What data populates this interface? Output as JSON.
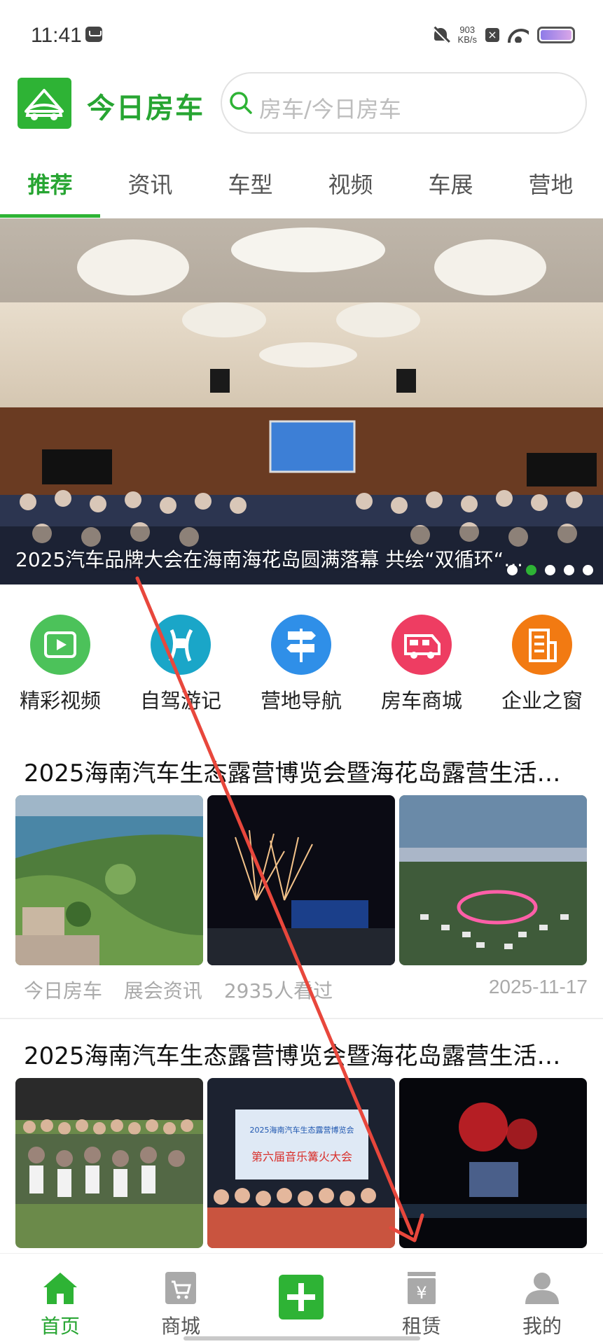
{
  "status_bar": {
    "time": "11:41",
    "net_speed_value": "903",
    "net_speed_unit": "KB/s",
    "icons": [
      "message-icon",
      "mute-icon",
      "close-icon",
      "wifi-icon",
      "battery-icon"
    ]
  },
  "header": {
    "app_name": "今日房车",
    "search_placeholder": "房车/今日房车"
  },
  "tabs": [
    {
      "label": "推荐",
      "active": true
    },
    {
      "label": "资讯",
      "active": false
    },
    {
      "label": "车型",
      "active": false
    },
    {
      "label": "视频",
      "active": false
    },
    {
      "label": "车展",
      "active": false
    },
    {
      "label": "营地",
      "active": false
    }
  ],
  "banner": {
    "caption": "2025汽车品牌大会在海南海花岛圆满落幕 共绘“双循环“…",
    "dot_count": 5,
    "active_dot": 1
  },
  "quick_nav": [
    {
      "label": "精彩视频",
      "icon": "video-icon",
      "color": "#4cc25a"
    },
    {
      "label": "自驾游记",
      "icon": "road-trip-icon",
      "color": "#1aa6c8"
    },
    {
      "label": "营地导航",
      "icon": "signpost-icon",
      "color": "#2f8fe8"
    },
    {
      "label": "房车商城",
      "icon": "rv-icon",
      "color": "#ee3d62"
    },
    {
      "label": "企业之窗",
      "icon": "building-icon",
      "color": "#f27a12"
    }
  ],
  "articles": [
    {
      "title": "2025海南汽车生态露营博览会暨海花岛露营生活…",
      "source": "今日房车",
      "category": "展会资讯",
      "views": "2935人看过",
      "date": "2025-11-17"
    },
    {
      "title": "2025海南汽车生态露营博览会暨海花岛露营生活…",
      "thumb_text": "第六届音乐篝火大会",
      "thumb_banner": "2025海南汽车生态露营博览会"
    }
  ],
  "bottom_nav": [
    {
      "label": "首页",
      "icon": "home-icon",
      "active": true
    },
    {
      "label": "商城",
      "icon": "cart-icon",
      "active": false
    },
    {
      "label": "",
      "icon": "publish-plus-icon",
      "active": false
    },
    {
      "label": "租赁",
      "icon": "rent-icon",
      "active": false
    },
    {
      "label": "我的",
      "icon": "profile-icon",
      "active": false
    }
  ],
  "colors": {
    "brand_green": "#2eb335",
    "annotation_arrow": "#e8473c"
  }
}
